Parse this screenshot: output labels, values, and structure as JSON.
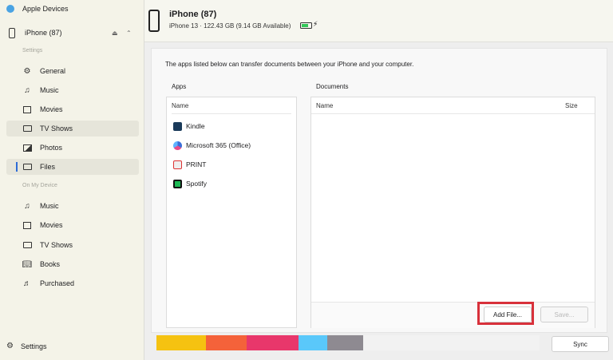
{
  "sidebar": {
    "app_title": "Apple Devices",
    "device_name": "iPhone (87)",
    "settings_heading": "Settings",
    "settings_items": [
      {
        "label": "General",
        "icon": "gear-icon"
      },
      {
        "label": "Music",
        "icon": "music-note-icon"
      },
      {
        "label": "Movies",
        "icon": "film-icon"
      },
      {
        "label": "TV Shows",
        "icon": "tv-icon"
      },
      {
        "label": "Photos",
        "icon": "photo-icon"
      },
      {
        "label": "Files",
        "icon": "folder-icon"
      }
    ],
    "on_device_heading": "On My Device",
    "device_items": [
      {
        "label": "Music",
        "icon": "music-note-icon"
      },
      {
        "label": "Movies",
        "icon": "film-icon"
      },
      {
        "label": "TV Shows",
        "icon": "tv-icon"
      },
      {
        "label": "Books",
        "icon": "book-icon"
      },
      {
        "label": "Purchased",
        "icon": "purchased-icon"
      }
    ],
    "footer_settings": "Settings",
    "selected_item": "Files"
  },
  "header": {
    "device_title": "iPhone (87)",
    "device_info": "iPhone 13 · 122.43 GB (9.14 GB Available)"
  },
  "main": {
    "description": "The apps listed below can transfer documents between your iPhone and your computer.",
    "apps_heading": "Apps",
    "apps_column": "Name",
    "apps": [
      {
        "name": "Kindle",
        "color": "#1a3a5a"
      },
      {
        "name": "Microsoft 365 (Office)",
        "color": "#3b6fd8"
      },
      {
        "name": "PRINT",
        "color": "#e9e9e9"
      },
      {
        "name": "Spotify",
        "color": "#1db954"
      }
    ],
    "documents_heading": "Documents",
    "documents_name_column": "Name",
    "documents_size_column": "Size",
    "add_file_label": "Add File...",
    "save_label": "Save..."
  },
  "footer": {
    "sync_label": "Sync",
    "storage_segments": [
      {
        "color": "#f5c211",
        "fraction": 0.13
      },
      {
        "color": "#f4623a",
        "fraction": 0.105
      },
      {
        "color": "#e8376b",
        "fraction": 0.135
      },
      {
        "color": "#5ac8fa",
        "fraction": 0.075
      },
      {
        "color": "#8e8a91",
        "fraction": 0.095
      }
    ]
  },
  "colors": {
    "highlight": "#d8313b",
    "selection_bar": "#2d6bd6"
  }
}
